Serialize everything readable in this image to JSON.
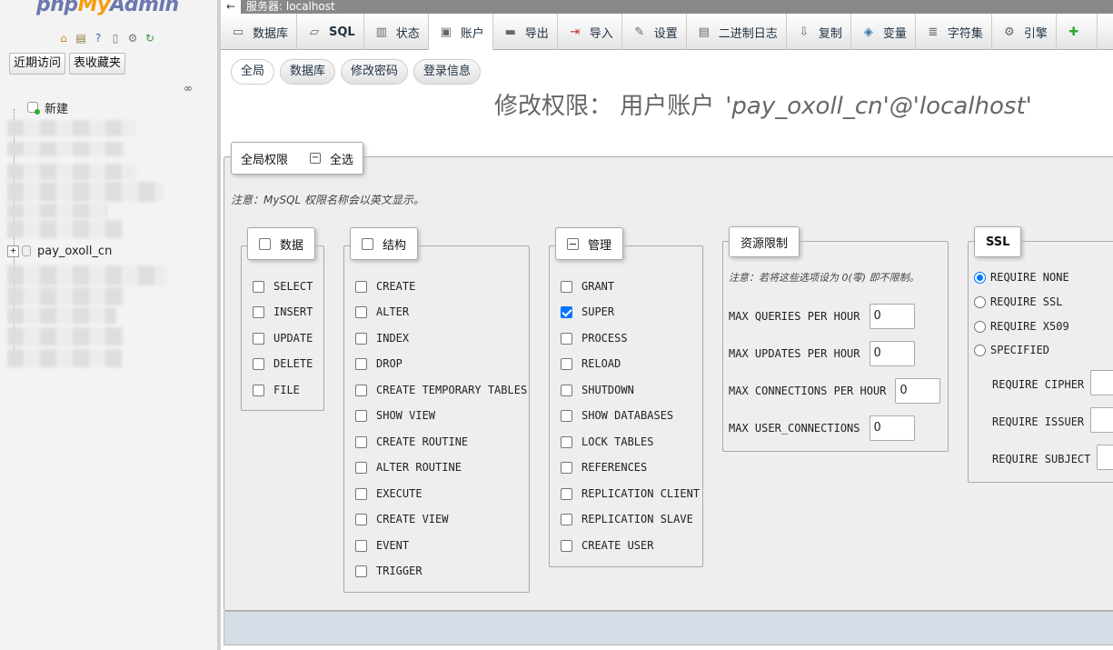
{
  "nav": {
    "logo": {
      "php": "php",
      "my": "My",
      "admin": "Admin"
    },
    "icons": [
      "home-icon",
      "database-icon",
      "help-icon",
      "docs-icon",
      "settings-icon",
      "reload-icon"
    ],
    "recent_label": "近期访问",
    "favorites_label": "表收藏夹",
    "tree": {
      "new_label": "新建",
      "visible_db": "pay_oxoll_cn"
    }
  },
  "server_bar": {
    "arrow": "←",
    "label": "服务器: localhost"
  },
  "tabs": [
    {
      "label": "数据库",
      "icon": "database-icon"
    },
    {
      "label": "SQL",
      "icon": "sql-icon"
    },
    {
      "label": "状态",
      "icon": "status-icon"
    },
    {
      "label": "账户",
      "icon": "users-icon"
    },
    {
      "label": "导出",
      "icon": "export-icon"
    },
    {
      "label": "导入",
      "icon": "import-icon"
    },
    {
      "label": "设置",
      "icon": "wrench-icon"
    },
    {
      "label": "二进制日志",
      "icon": "binlog-icon"
    },
    {
      "label": "复制",
      "icon": "replication-icon"
    },
    {
      "label": "变量",
      "icon": "variables-icon"
    },
    {
      "label": "字符集",
      "icon": "charset-icon"
    },
    {
      "label": "引擎",
      "icon": "engine-icon"
    }
  ],
  "active_tab": "账户",
  "subtabs": [
    {
      "label": "全局"
    },
    {
      "label": "数据库"
    },
    {
      "label": "修改密码"
    },
    {
      "label": "登录信息"
    }
  ],
  "page_title": {
    "prefix": "修改权限：  用户账户",
    "user": "'pay_oxoll_cn'@'localhost'"
  },
  "global": {
    "legend": "全局权限",
    "select_all": "全选",
    "note": "注意：MySQL 权限名称会以英文显示。"
  },
  "groups": {
    "data": {
      "legend": "数据",
      "privileges": [
        {
          "name": "SELECT",
          "checked": false
        },
        {
          "name": "INSERT",
          "checked": false
        },
        {
          "name": "UPDATE",
          "checked": false
        },
        {
          "name": "DELETE",
          "checked": false
        },
        {
          "name": "FILE",
          "checked": false
        }
      ]
    },
    "structure": {
      "legend": "结构",
      "privileges": [
        {
          "name": "CREATE",
          "checked": false
        },
        {
          "name": "ALTER",
          "checked": false
        },
        {
          "name": "INDEX",
          "checked": false
        },
        {
          "name": "DROP",
          "checked": false
        },
        {
          "name": "CREATE TEMPORARY TABLES",
          "checked": false
        },
        {
          "name": "SHOW VIEW",
          "checked": false
        },
        {
          "name": "CREATE ROUTINE",
          "checked": false
        },
        {
          "name": "ALTER ROUTINE",
          "checked": false
        },
        {
          "name": "EXECUTE",
          "checked": false
        },
        {
          "name": "CREATE VIEW",
          "checked": false
        },
        {
          "name": "EVENT",
          "checked": false
        },
        {
          "name": "TRIGGER",
          "checked": false
        }
      ]
    },
    "admin": {
      "legend": "管理",
      "privileges": [
        {
          "name": "GRANT",
          "checked": false
        },
        {
          "name": "SUPER",
          "checked": true
        },
        {
          "name": "PROCESS",
          "checked": false
        },
        {
          "name": "RELOAD",
          "checked": false
        },
        {
          "name": "SHUTDOWN",
          "checked": false
        },
        {
          "name": "SHOW DATABASES",
          "checked": false
        },
        {
          "name": "LOCK TABLES",
          "checked": false
        },
        {
          "name": "REFERENCES",
          "checked": false
        },
        {
          "name": "REPLICATION CLIENT",
          "checked": false
        },
        {
          "name": "REPLICATION SLAVE",
          "checked": false
        },
        {
          "name": "CREATE USER",
          "checked": false
        }
      ]
    }
  },
  "limits": {
    "legend": "资源限制",
    "note": "注意：若将这些选项设为 0(零) 即不限制。",
    "rows": [
      {
        "label": "MAX QUERIES PER HOUR",
        "value": "0"
      },
      {
        "label": "MAX UPDATES PER HOUR",
        "value": "0"
      },
      {
        "label": "MAX CONNECTIONS PER HOUR",
        "value": "0"
      },
      {
        "label": "MAX USER_CONNECTIONS",
        "value": "0"
      }
    ]
  },
  "ssl": {
    "legend": "SSL",
    "options": [
      {
        "label": "REQUIRE NONE",
        "selected": true
      },
      {
        "label": "REQUIRE SSL",
        "selected": false
      },
      {
        "label": "REQUIRE X509",
        "selected": false
      },
      {
        "label": "SPECIFIED",
        "selected": false
      }
    ],
    "fields": [
      {
        "label": "REQUIRE CIPHER"
      },
      {
        "label": "REQUIRE ISSUER"
      },
      {
        "label": "REQUIRE SUBJECT"
      }
    ]
  }
}
